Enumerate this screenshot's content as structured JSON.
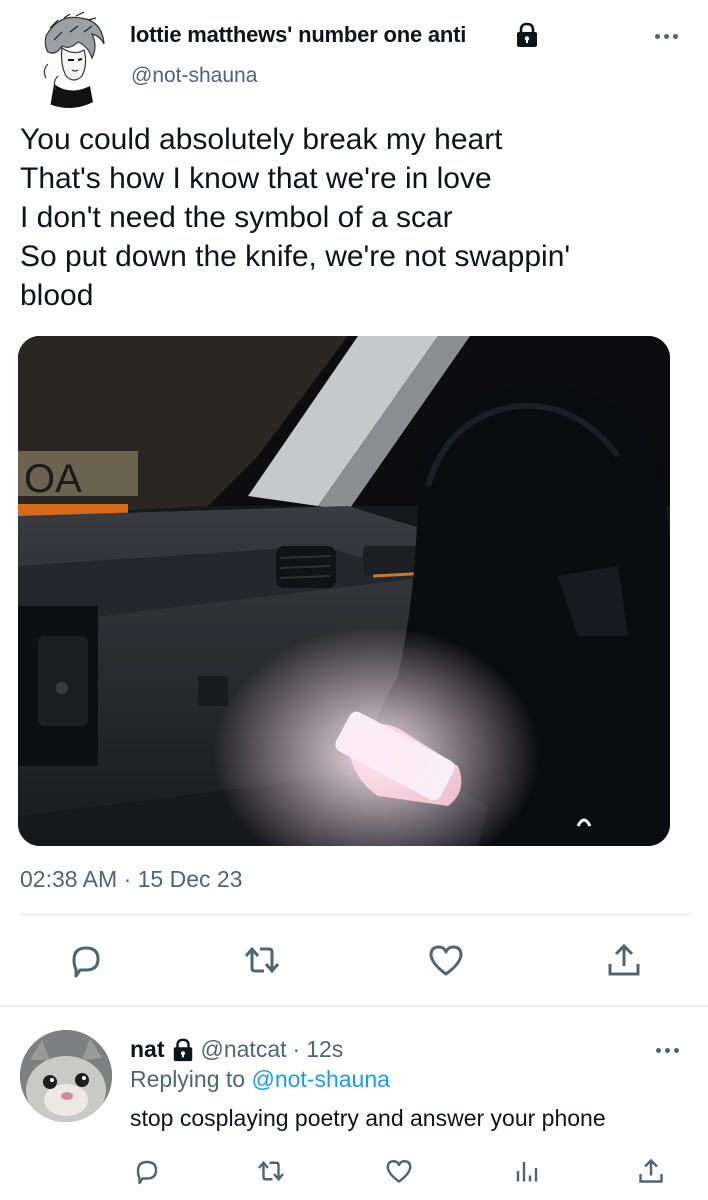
{
  "tweet": {
    "author_name": "lottie matthews' number one anti",
    "author_handle": "@not-shauna",
    "body": "You could absolutely break my heart\nThat's how I know that we're in love\nI don't need the symbol of a scar\nSo put down the knife, we're not swappin'\nblood",
    "media_text": "OA",
    "timestamp": "02:38 AM · 15 Dec 23",
    "actions": [
      "reply-icon",
      "retweet-icon",
      "like-icon",
      "share-icon"
    ]
  },
  "reply": {
    "author_name": "nat",
    "author_handle": "@natcat",
    "separator": "·",
    "time": "12s",
    "replying_prefix": "Replying to",
    "replying_to": "@not-shauna",
    "text": "stop cosplaying poetry and answer your phone",
    "actions": [
      "reply-icon",
      "retweet-icon",
      "like-icon",
      "views-icon",
      "share-icon"
    ]
  },
  "colors": {
    "text": "#0f1419",
    "secondary": "#536471",
    "link": "#1d9bf0",
    "divider": "#eff3f4"
  }
}
